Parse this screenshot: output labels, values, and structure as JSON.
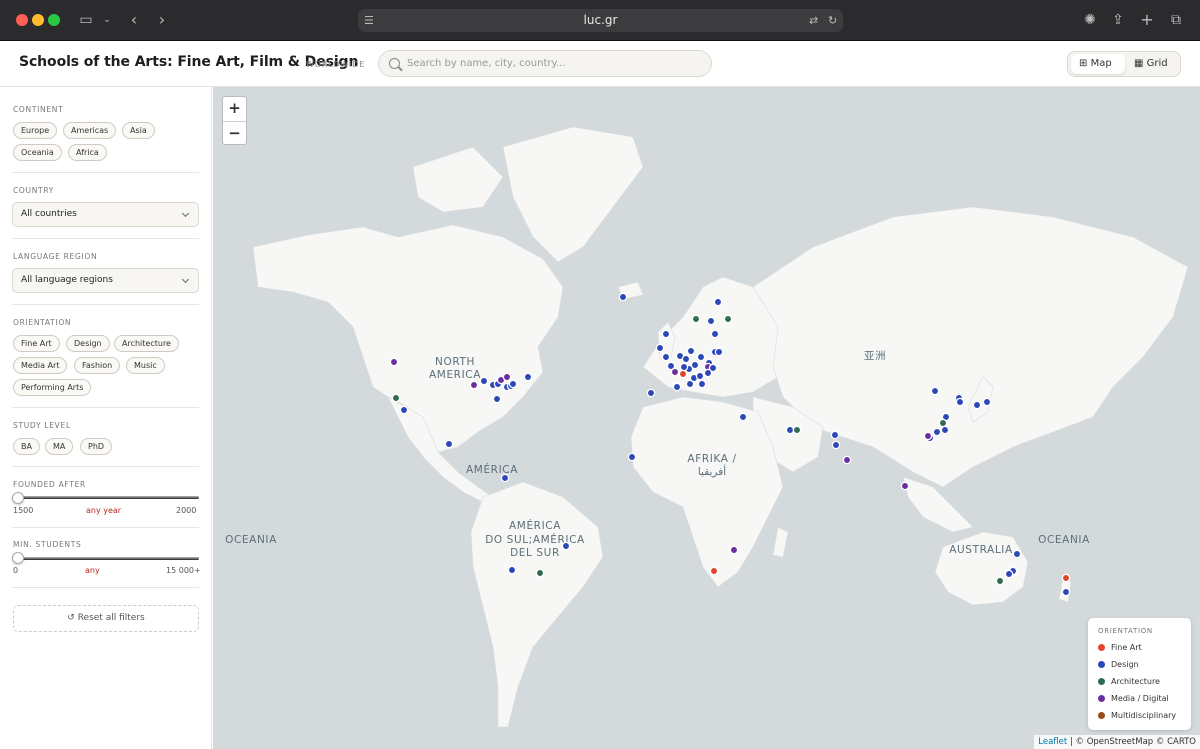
{
  "browser": {
    "url": "luc.gr"
  },
  "header": {
    "title": "Schools of the Arts: Fine Art, Film & Design",
    "subtitle": "WORLDWIDE",
    "search_placeholder": "Search by name, city, country...",
    "view_map": "Map",
    "view_grid": "Grid",
    "active_view": "Map"
  },
  "filters": {
    "continent": {
      "label": "CONTINENT",
      "chips": [
        "Europe",
        "Americas",
        "Asia",
        "Oceania",
        "Africa"
      ]
    },
    "country": {
      "label": "COUNTRY",
      "value": "All countries"
    },
    "language": {
      "label": "LANGUAGE REGION",
      "value": "All language regions"
    },
    "orientation": {
      "label": "ORIENTATION",
      "chips": [
        "Fine Art",
        "Design",
        "Architecture",
        "Media Art",
        "Fashion",
        "Music",
        "Performing Arts"
      ]
    },
    "study_level": {
      "label": "STUDY LEVEL",
      "chips": [
        "BA",
        "MA",
        "PhD"
      ]
    },
    "founded": {
      "label": "FOUNDED AFTER",
      "min": "1500",
      "current": "any year",
      "max": "2000"
    },
    "students": {
      "label": "MIN. STUDENTS",
      "min": "0",
      "current": "any",
      "max": "15 000+"
    },
    "reset_label": "↺ Reset all filters"
  },
  "map": {
    "zoom_in": "+",
    "zoom_out": "−",
    "labels": {
      "north_america": [
        "NORTH",
        "AMERICA"
      ],
      "america": "AMÉRICA",
      "south_america": [
        "AMÉRICA",
        "DO SUL;AMÉRICA",
        "DEL SUR"
      ],
      "africa": [
        "AFRIKA /",
        "أفريقيا"
      ],
      "asia": "亚洲",
      "australia": "AUSTRALIA",
      "oceania_left": "OCEANIA",
      "oceania_right": "OCEANIA"
    },
    "legend": {
      "title": "ORIENTATION",
      "items": [
        {
          "name": "Fine Art",
          "color": "#e0452b"
        },
        {
          "name": "Design",
          "color": "#2b47b8"
        },
        {
          "name": "Architecture",
          "color": "#2e6b4f"
        },
        {
          "name": "Media / Digital",
          "color": "#6a2ea0"
        },
        {
          "name": "Multidisciplinary",
          "color": "#9a4a17"
        }
      ]
    },
    "attribution": {
      "leaflet": "Leaflet",
      "rest": "| © OpenStreetMap © CARTO"
    }
  }
}
